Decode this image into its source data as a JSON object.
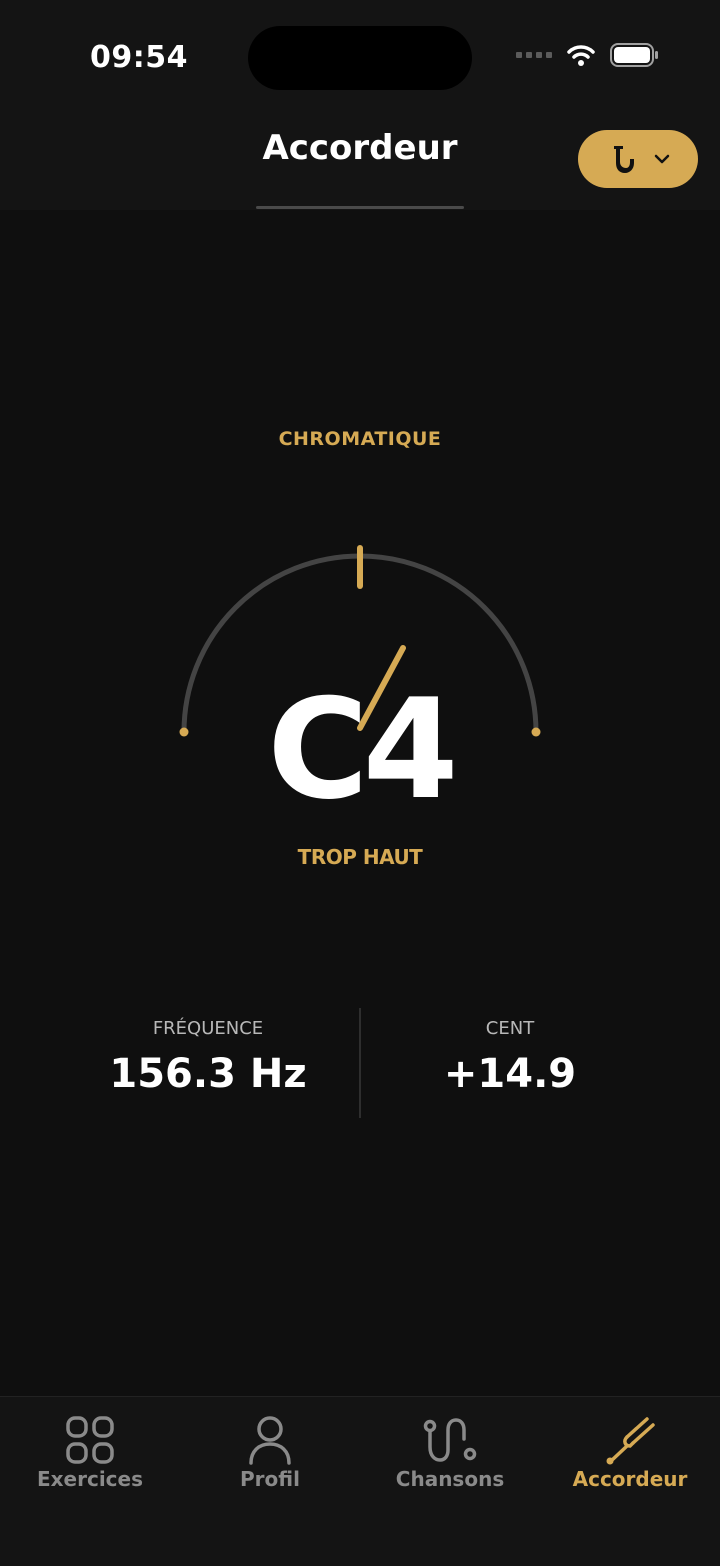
{
  "status_bar": {
    "time": "09:54"
  },
  "header": {
    "title": "Accordeur",
    "instrument_icon": "saxophone-icon"
  },
  "tuner": {
    "mode": "CHROMATIQUE",
    "note": "C4",
    "status": "TROP HAUT",
    "frequency_label": "FRÉQUENCE",
    "frequency_value": "156.3 Hz",
    "cent_label": "CENT",
    "cent_value": "+14.9"
  },
  "tabbar": {
    "items": [
      {
        "label": "Exercices",
        "icon": "grid-icon",
        "active": false
      },
      {
        "label": "Profil",
        "icon": "user-icon",
        "active": false
      },
      {
        "label": "Chansons",
        "icon": "route-icon",
        "active": false
      },
      {
        "label": "Accordeur",
        "icon": "tuning-fork-icon",
        "active": true
      }
    ]
  },
  "colors": {
    "accent": "#d6aa54",
    "background": "#0f0f0f",
    "surface": "#141414",
    "inactive": "#8a8a8a"
  }
}
